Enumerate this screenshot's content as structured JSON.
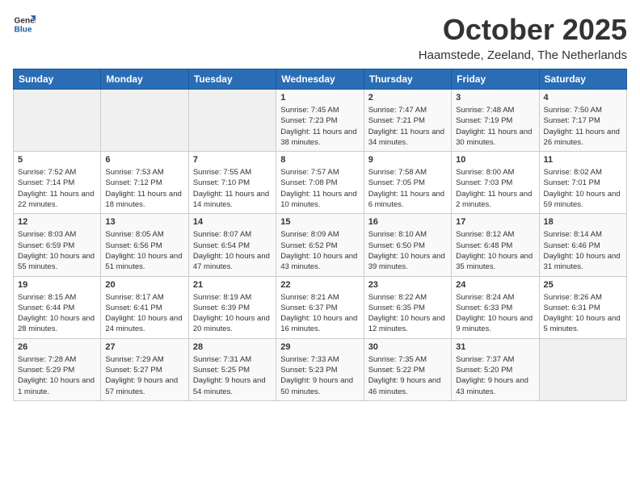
{
  "logo": {
    "general": "General",
    "blue": "Blue"
  },
  "header": {
    "month": "October 2025",
    "location": "Haamstede, Zeeland, The Netherlands"
  },
  "weekdays": [
    "Sunday",
    "Monday",
    "Tuesday",
    "Wednesday",
    "Thursday",
    "Friday",
    "Saturday"
  ],
  "weeks": [
    [
      {
        "day": "",
        "info": ""
      },
      {
        "day": "",
        "info": ""
      },
      {
        "day": "",
        "info": ""
      },
      {
        "day": "1",
        "info": "Sunrise: 7:45 AM\nSunset: 7:23 PM\nDaylight: 11 hours and 38 minutes."
      },
      {
        "day": "2",
        "info": "Sunrise: 7:47 AM\nSunset: 7:21 PM\nDaylight: 11 hours and 34 minutes."
      },
      {
        "day": "3",
        "info": "Sunrise: 7:48 AM\nSunset: 7:19 PM\nDaylight: 11 hours and 30 minutes."
      },
      {
        "day": "4",
        "info": "Sunrise: 7:50 AM\nSunset: 7:17 PM\nDaylight: 11 hours and 26 minutes."
      }
    ],
    [
      {
        "day": "5",
        "info": "Sunrise: 7:52 AM\nSunset: 7:14 PM\nDaylight: 11 hours and 22 minutes."
      },
      {
        "day": "6",
        "info": "Sunrise: 7:53 AM\nSunset: 7:12 PM\nDaylight: 11 hours and 18 minutes."
      },
      {
        "day": "7",
        "info": "Sunrise: 7:55 AM\nSunset: 7:10 PM\nDaylight: 11 hours and 14 minutes."
      },
      {
        "day": "8",
        "info": "Sunrise: 7:57 AM\nSunset: 7:08 PM\nDaylight: 11 hours and 10 minutes."
      },
      {
        "day": "9",
        "info": "Sunrise: 7:58 AM\nSunset: 7:05 PM\nDaylight: 11 hours and 6 minutes."
      },
      {
        "day": "10",
        "info": "Sunrise: 8:00 AM\nSunset: 7:03 PM\nDaylight: 11 hours and 2 minutes."
      },
      {
        "day": "11",
        "info": "Sunrise: 8:02 AM\nSunset: 7:01 PM\nDaylight: 10 hours and 59 minutes."
      }
    ],
    [
      {
        "day": "12",
        "info": "Sunrise: 8:03 AM\nSunset: 6:59 PM\nDaylight: 10 hours and 55 minutes."
      },
      {
        "day": "13",
        "info": "Sunrise: 8:05 AM\nSunset: 6:56 PM\nDaylight: 10 hours and 51 minutes."
      },
      {
        "day": "14",
        "info": "Sunrise: 8:07 AM\nSunset: 6:54 PM\nDaylight: 10 hours and 47 minutes."
      },
      {
        "day": "15",
        "info": "Sunrise: 8:09 AM\nSunset: 6:52 PM\nDaylight: 10 hours and 43 minutes."
      },
      {
        "day": "16",
        "info": "Sunrise: 8:10 AM\nSunset: 6:50 PM\nDaylight: 10 hours and 39 minutes."
      },
      {
        "day": "17",
        "info": "Sunrise: 8:12 AM\nSunset: 6:48 PM\nDaylight: 10 hours and 35 minutes."
      },
      {
        "day": "18",
        "info": "Sunrise: 8:14 AM\nSunset: 6:46 PM\nDaylight: 10 hours and 31 minutes."
      }
    ],
    [
      {
        "day": "19",
        "info": "Sunrise: 8:15 AM\nSunset: 6:44 PM\nDaylight: 10 hours and 28 minutes."
      },
      {
        "day": "20",
        "info": "Sunrise: 8:17 AM\nSunset: 6:41 PM\nDaylight: 10 hours and 24 minutes."
      },
      {
        "day": "21",
        "info": "Sunrise: 8:19 AM\nSunset: 6:39 PM\nDaylight: 10 hours and 20 minutes."
      },
      {
        "day": "22",
        "info": "Sunrise: 8:21 AM\nSunset: 6:37 PM\nDaylight: 10 hours and 16 minutes."
      },
      {
        "day": "23",
        "info": "Sunrise: 8:22 AM\nSunset: 6:35 PM\nDaylight: 10 hours and 12 minutes."
      },
      {
        "day": "24",
        "info": "Sunrise: 8:24 AM\nSunset: 6:33 PM\nDaylight: 10 hours and 9 minutes."
      },
      {
        "day": "25",
        "info": "Sunrise: 8:26 AM\nSunset: 6:31 PM\nDaylight: 10 hours and 5 minutes."
      }
    ],
    [
      {
        "day": "26",
        "info": "Sunrise: 7:28 AM\nSunset: 5:29 PM\nDaylight: 10 hours and 1 minute."
      },
      {
        "day": "27",
        "info": "Sunrise: 7:29 AM\nSunset: 5:27 PM\nDaylight: 9 hours and 57 minutes."
      },
      {
        "day": "28",
        "info": "Sunrise: 7:31 AM\nSunset: 5:25 PM\nDaylight: 9 hours and 54 minutes."
      },
      {
        "day": "29",
        "info": "Sunrise: 7:33 AM\nSunset: 5:23 PM\nDaylight: 9 hours and 50 minutes."
      },
      {
        "day": "30",
        "info": "Sunrise: 7:35 AM\nSunset: 5:22 PM\nDaylight: 9 hours and 46 minutes."
      },
      {
        "day": "31",
        "info": "Sunrise: 7:37 AM\nSunset: 5:20 PM\nDaylight: 9 hours and 43 minutes."
      },
      {
        "day": "",
        "info": ""
      }
    ]
  ]
}
